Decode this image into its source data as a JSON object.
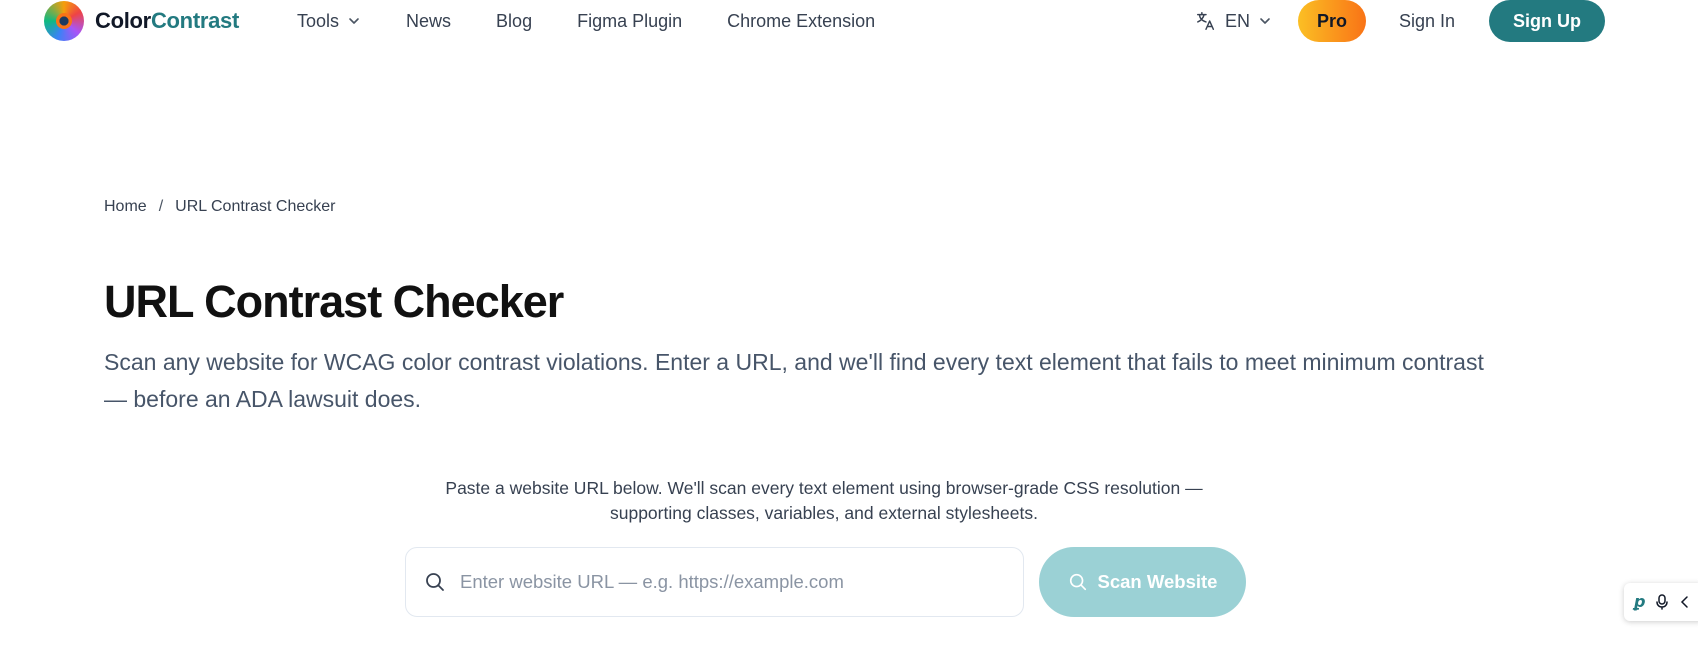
{
  "header": {
    "logo": {
      "part1": "Color",
      "part2": "Contrast"
    },
    "nav": [
      {
        "label": "Tools",
        "dropdown": true
      },
      {
        "label": "News"
      },
      {
        "label": "Blog"
      },
      {
        "label": "Figma Plugin"
      },
      {
        "label": "Chrome Extension"
      }
    ],
    "language": "EN",
    "pro_label": "Pro",
    "signin_label": "Sign In",
    "signup_label": "Sign Up"
  },
  "breadcrumb": {
    "home": "Home",
    "separator": "/",
    "current": "URL Contrast Checker"
  },
  "main": {
    "title": "URL Contrast Checker",
    "subtitle": "Scan any website for WCAG color contrast violations. Enter a URL, and we'll find every text element that fails to meet minimum contrast — before an ADA lawsuit does.",
    "hint": "Paste a website URL below. We'll scan every text element using browser-grade CSS resolution — supporting classes, variables, and external stylesheets.",
    "search": {
      "placeholder": "Enter website URL — e.g. https://example.com",
      "value": ""
    },
    "scan_button": "Scan Website"
  },
  "colors": {
    "brand": "#237a80",
    "pro_gradient_start": "#fbbf24",
    "pro_gradient_end": "#f97316",
    "scan_button_disabled": "#9bd1d5"
  },
  "icons": {
    "tools_dropdown": "chevron-down-icon",
    "language": "translate-icon",
    "search": "search-icon"
  }
}
